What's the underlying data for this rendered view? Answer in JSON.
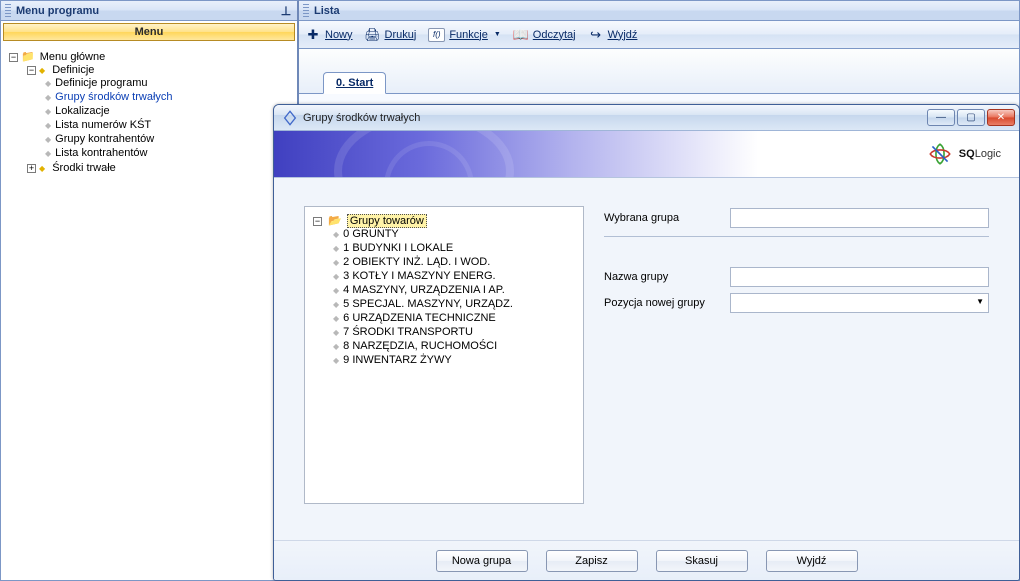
{
  "leftPanel": {
    "title": "Menu programu",
    "menuBand": "Menu",
    "root": "Menu główne",
    "defNode": "Definicje",
    "items": [
      "Definicje programu",
      "Grupy środków trwałych",
      "Lokalizacje",
      "Lista numerów KŚT",
      "Grupy kontrahentów",
      "Lista kontrahentów"
    ],
    "fixedAssets": "Środki trwałe"
  },
  "rightPanel": {
    "title": "Lista",
    "toolbar": {
      "new": "Nowy",
      "print": "Drukuj",
      "functions": "Funkcje",
      "read": "Odczytaj",
      "exit": "Wyjdź"
    },
    "tab": "0. Start"
  },
  "dialog": {
    "title": "Grupy środków trwałych",
    "logo1": "SQ",
    "logo2": "Logic",
    "treeRoot": "Grupy towarów",
    "treeItems": [
      "0 GRUNTY",
      "1 BUDYNKI I LOKALE",
      "2 OBIEKTY INŻ. LĄD. I WOD.",
      "3 KOTŁY I MASZYNY ENERG.",
      "4 MASZYNY, URZĄDZENIA I AP.",
      "5 SPECJAL. MASZYNY, URZĄDZ.",
      "6 URZĄDZENIA TECHNICZNE",
      "7 ŚRODKI TRANSPORTU",
      "8 NARZĘDZIA, RUCHOMOŚCI",
      "9 INWENTARZ ŻYWY"
    ],
    "labels": {
      "selectedGroup": "Wybrana grupa",
      "groupName": "Nazwa grupy",
      "newGroupPos": "Pozycja nowej grupy"
    },
    "buttons": {
      "newGroup": "Nowa grupa",
      "save": "Zapisz",
      "delete": "Skasuj",
      "exit": "Wyjdź"
    }
  }
}
